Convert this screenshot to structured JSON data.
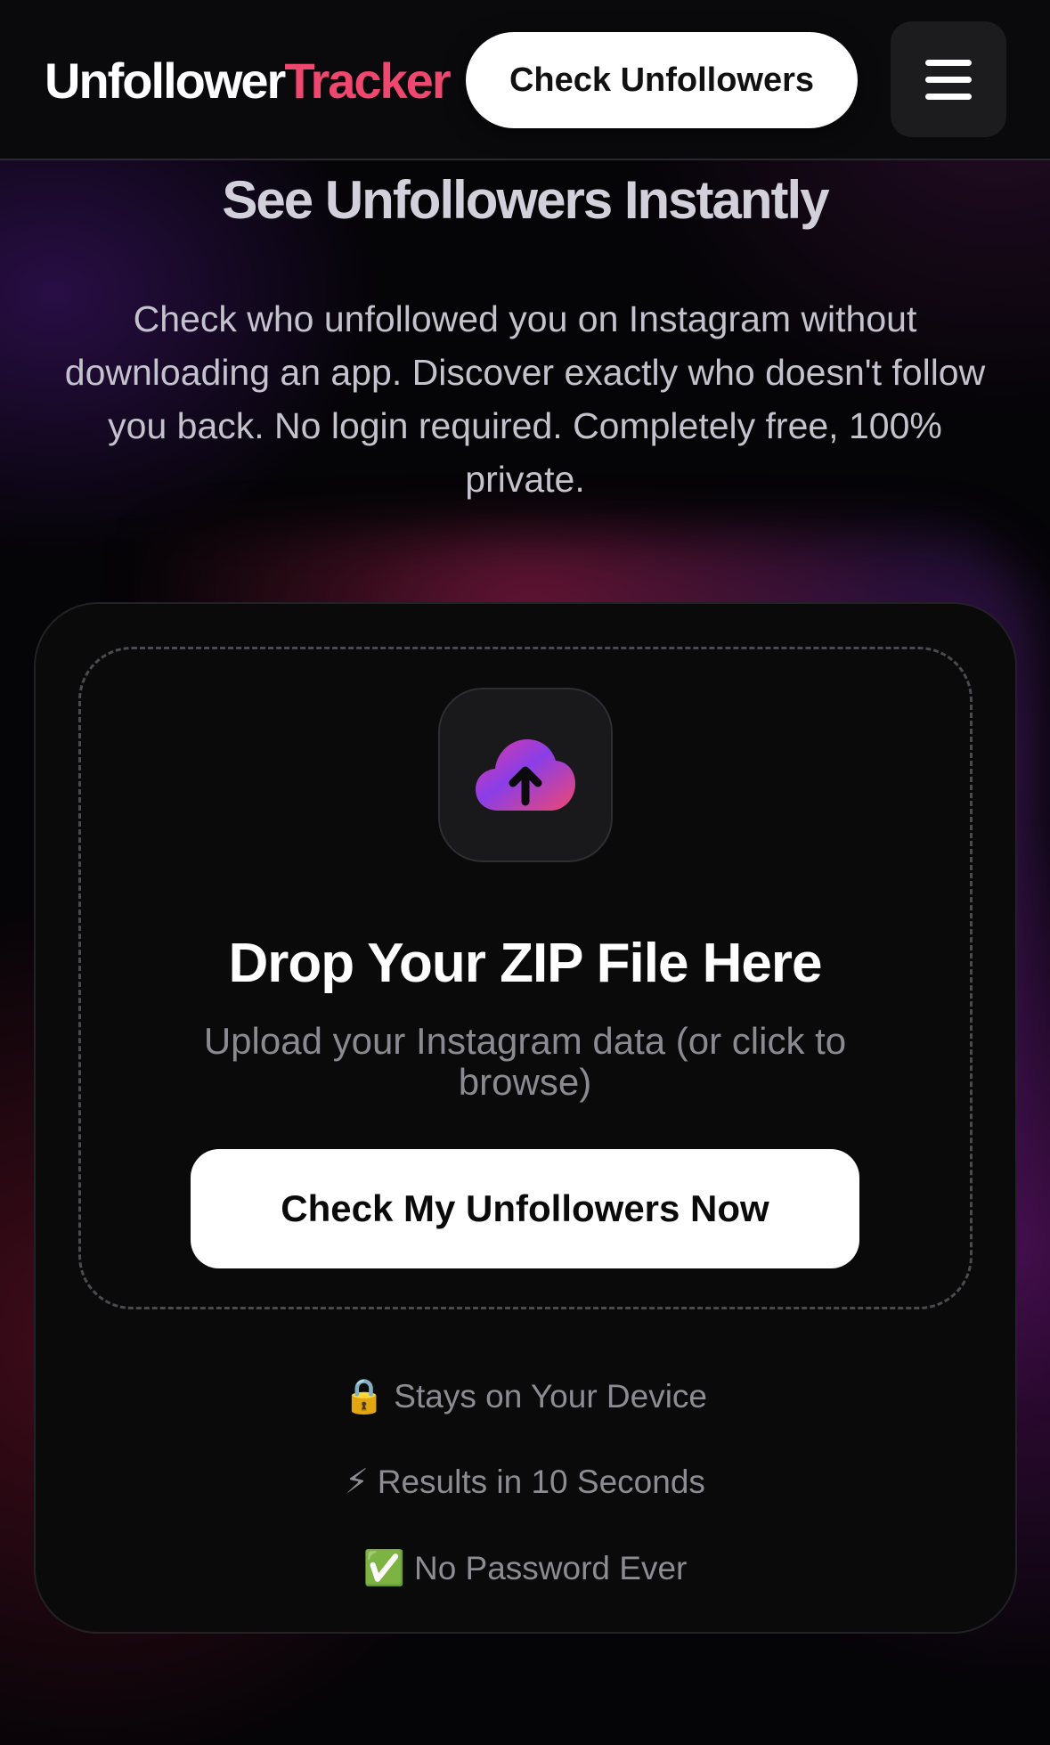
{
  "header": {
    "logo_main": "Unfollower",
    "logo_accent": "Tracker",
    "cta_label": "Check Unfollowers",
    "menu_icon": "hamburger-menu-icon"
  },
  "hero": {
    "title": "See Unfollowers Instantly",
    "subtitle": "Check who unfollowed you on Instagram without downloading an app. Discover exactly who doesn't follow you back. No login required. Completely free, 100% private."
  },
  "upload": {
    "icon": "cloud-upload-icon",
    "title": "Drop Your ZIP File Here",
    "subtitle": "Upload your Instagram data (or click to browse)",
    "button_label": "Check My Unfollowers Now"
  },
  "features": [
    {
      "icon": "🔒",
      "icon_name": "lock-icon",
      "label": "Stays on Your Device"
    },
    {
      "icon": "⚡",
      "icon_name": "lightning-icon",
      "label": "Results in 10 Seconds"
    },
    {
      "icon": "✅",
      "icon_name": "check-mark-icon",
      "label": "No Password Ever"
    }
  ],
  "colors": {
    "accent": "#f0476f",
    "background": "#050407",
    "card": "#0a0a0a",
    "icon_gradient_start": "#d63ab0",
    "icon_gradient_end": "#7a3df0"
  }
}
